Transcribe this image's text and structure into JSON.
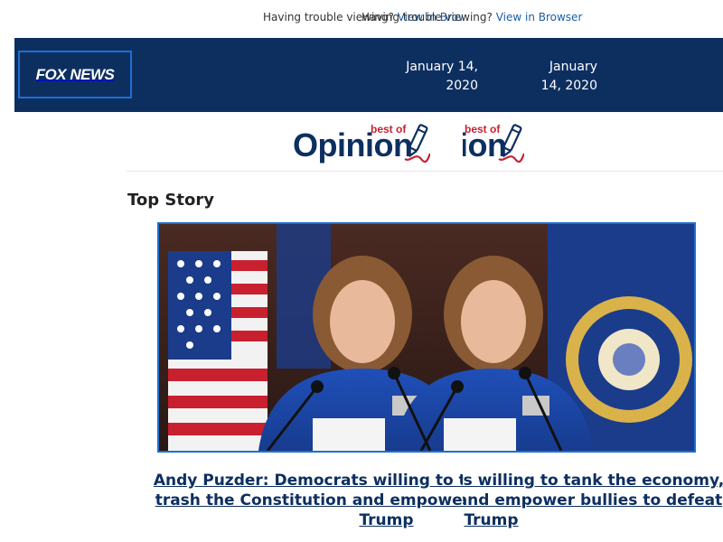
{
  "topbar": {
    "trouble_text": "Having trouble viewing? ",
    "view_link": "View in Browser"
  },
  "header": {
    "logo_text": "FOX NEWS",
    "date": "January 14, 2020"
  },
  "brand": {
    "opinion_word": "Opinion",
    "best_of": "best of"
  },
  "section": {
    "title": "Top Story"
  },
  "story": {
    "headline": "Andy Puzder: Democrats willing to tank the economy, trash the Constitution and empower bullies to defeat Trump"
  },
  "colors": {
    "header_bg": "#0d2f60",
    "link": "#1a5fa8",
    "accent_border": "#1f6fd0",
    "brand_red": "#c8202f",
    "headline": "#0d2f60"
  },
  "icons": [
    "fox-news-logo",
    "pen-icon"
  ]
}
